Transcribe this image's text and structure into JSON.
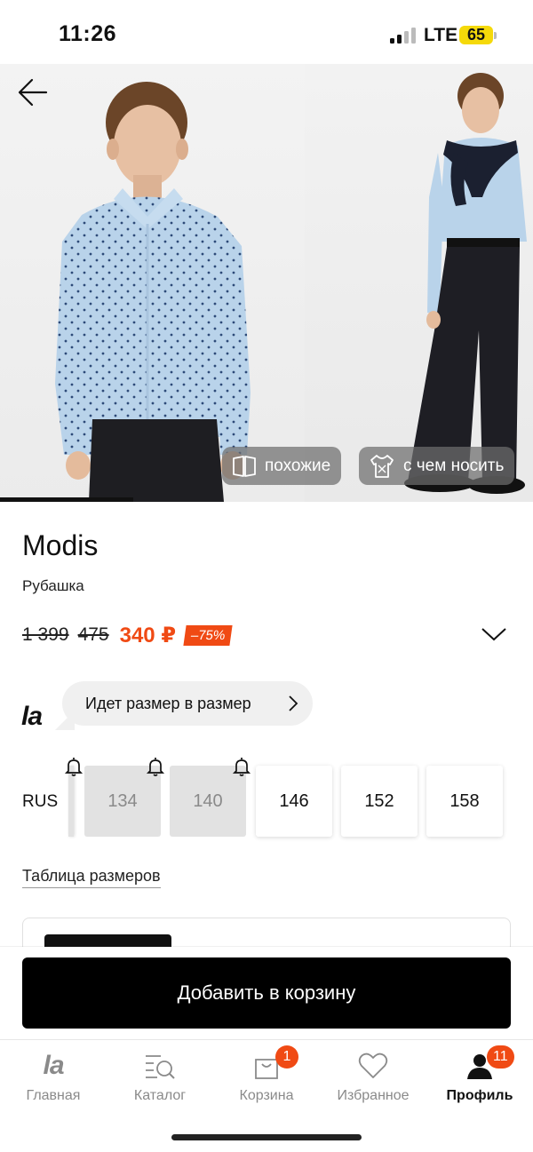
{
  "status_bar": {
    "time": "11:26",
    "network": "LTE",
    "battery": "65"
  },
  "gallery": {
    "chips": [
      {
        "label": "похожие",
        "icon": "book-icon"
      },
      {
        "label": "с чем носить",
        "icon": "outfit-icon"
      }
    ]
  },
  "product": {
    "brand": "Modis",
    "subtitle": "Рубашка",
    "prices": {
      "original": "1 399",
      "previous": "475",
      "current": "340 ₽",
      "discount": "–75%"
    }
  },
  "fit": {
    "logo": "la",
    "text": "Идет размер в размер"
  },
  "sizes": {
    "system": "RUS",
    "items": [
      {
        "label": "134",
        "available": false
      },
      {
        "label": "140",
        "available": false
      },
      {
        "label": "146",
        "available": true
      },
      {
        "label": "152",
        "available": true
      },
      {
        "label": "158",
        "available": true
      }
    ],
    "table_link": "Таблица размеров"
  },
  "cta": {
    "add_to_cart": "Добавить в корзину"
  },
  "tab_bar": {
    "items": [
      {
        "label": "Главная",
        "icon": "la-logo-icon",
        "active": false
      },
      {
        "label": "Каталог",
        "icon": "catalog-search-icon",
        "active": false
      },
      {
        "label": "Корзина",
        "icon": "bag-icon",
        "active": false,
        "badge": "1"
      },
      {
        "label": "Избранное",
        "icon": "heart-icon",
        "active": false
      },
      {
        "label": "Профиль",
        "icon": "user-icon",
        "active": true,
        "badge": "11"
      }
    ]
  },
  "colors": {
    "accent": "#f04a14",
    "cta": "#000000",
    "battery": "#f5d90a",
    "shirt": "#b9d3ea"
  }
}
